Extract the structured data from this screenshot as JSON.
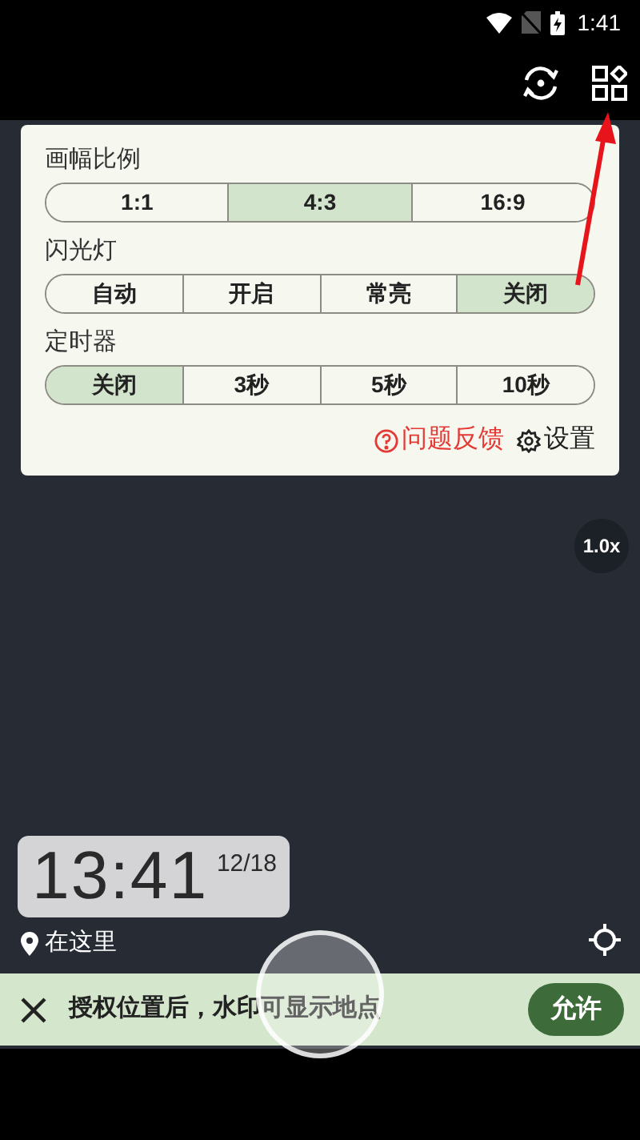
{
  "status_bar": {
    "time": "1:41"
  },
  "settings_panel": {
    "sections": [
      {
        "title": "画幅比例",
        "options": [
          {
            "label": "1:1",
            "selected": false
          },
          {
            "label": "4:3",
            "selected": true
          },
          {
            "label": "16:9",
            "selected": false
          }
        ]
      },
      {
        "title": "闪光灯",
        "options": [
          {
            "label": "自动",
            "selected": false
          },
          {
            "label": "开启",
            "selected": false
          },
          {
            "label": "常亮",
            "selected": false
          },
          {
            "label": "关闭",
            "selected": true
          }
        ]
      },
      {
        "title": "定时器",
        "options": [
          {
            "label": "关闭",
            "selected": true
          },
          {
            "label": "3秒",
            "selected": false
          },
          {
            "label": "5秒",
            "selected": false
          },
          {
            "label": "10秒",
            "selected": false
          }
        ]
      }
    ],
    "feedback_link": "问题反馈",
    "settings_link": "设置"
  },
  "zoom": "1.0x",
  "watermark": {
    "time": "13:41",
    "date": "12/18",
    "location": "在这里"
  },
  "banner": {
    "message": "授权位置后，水印可显示地点",
    "action": "允许"
  }
}
